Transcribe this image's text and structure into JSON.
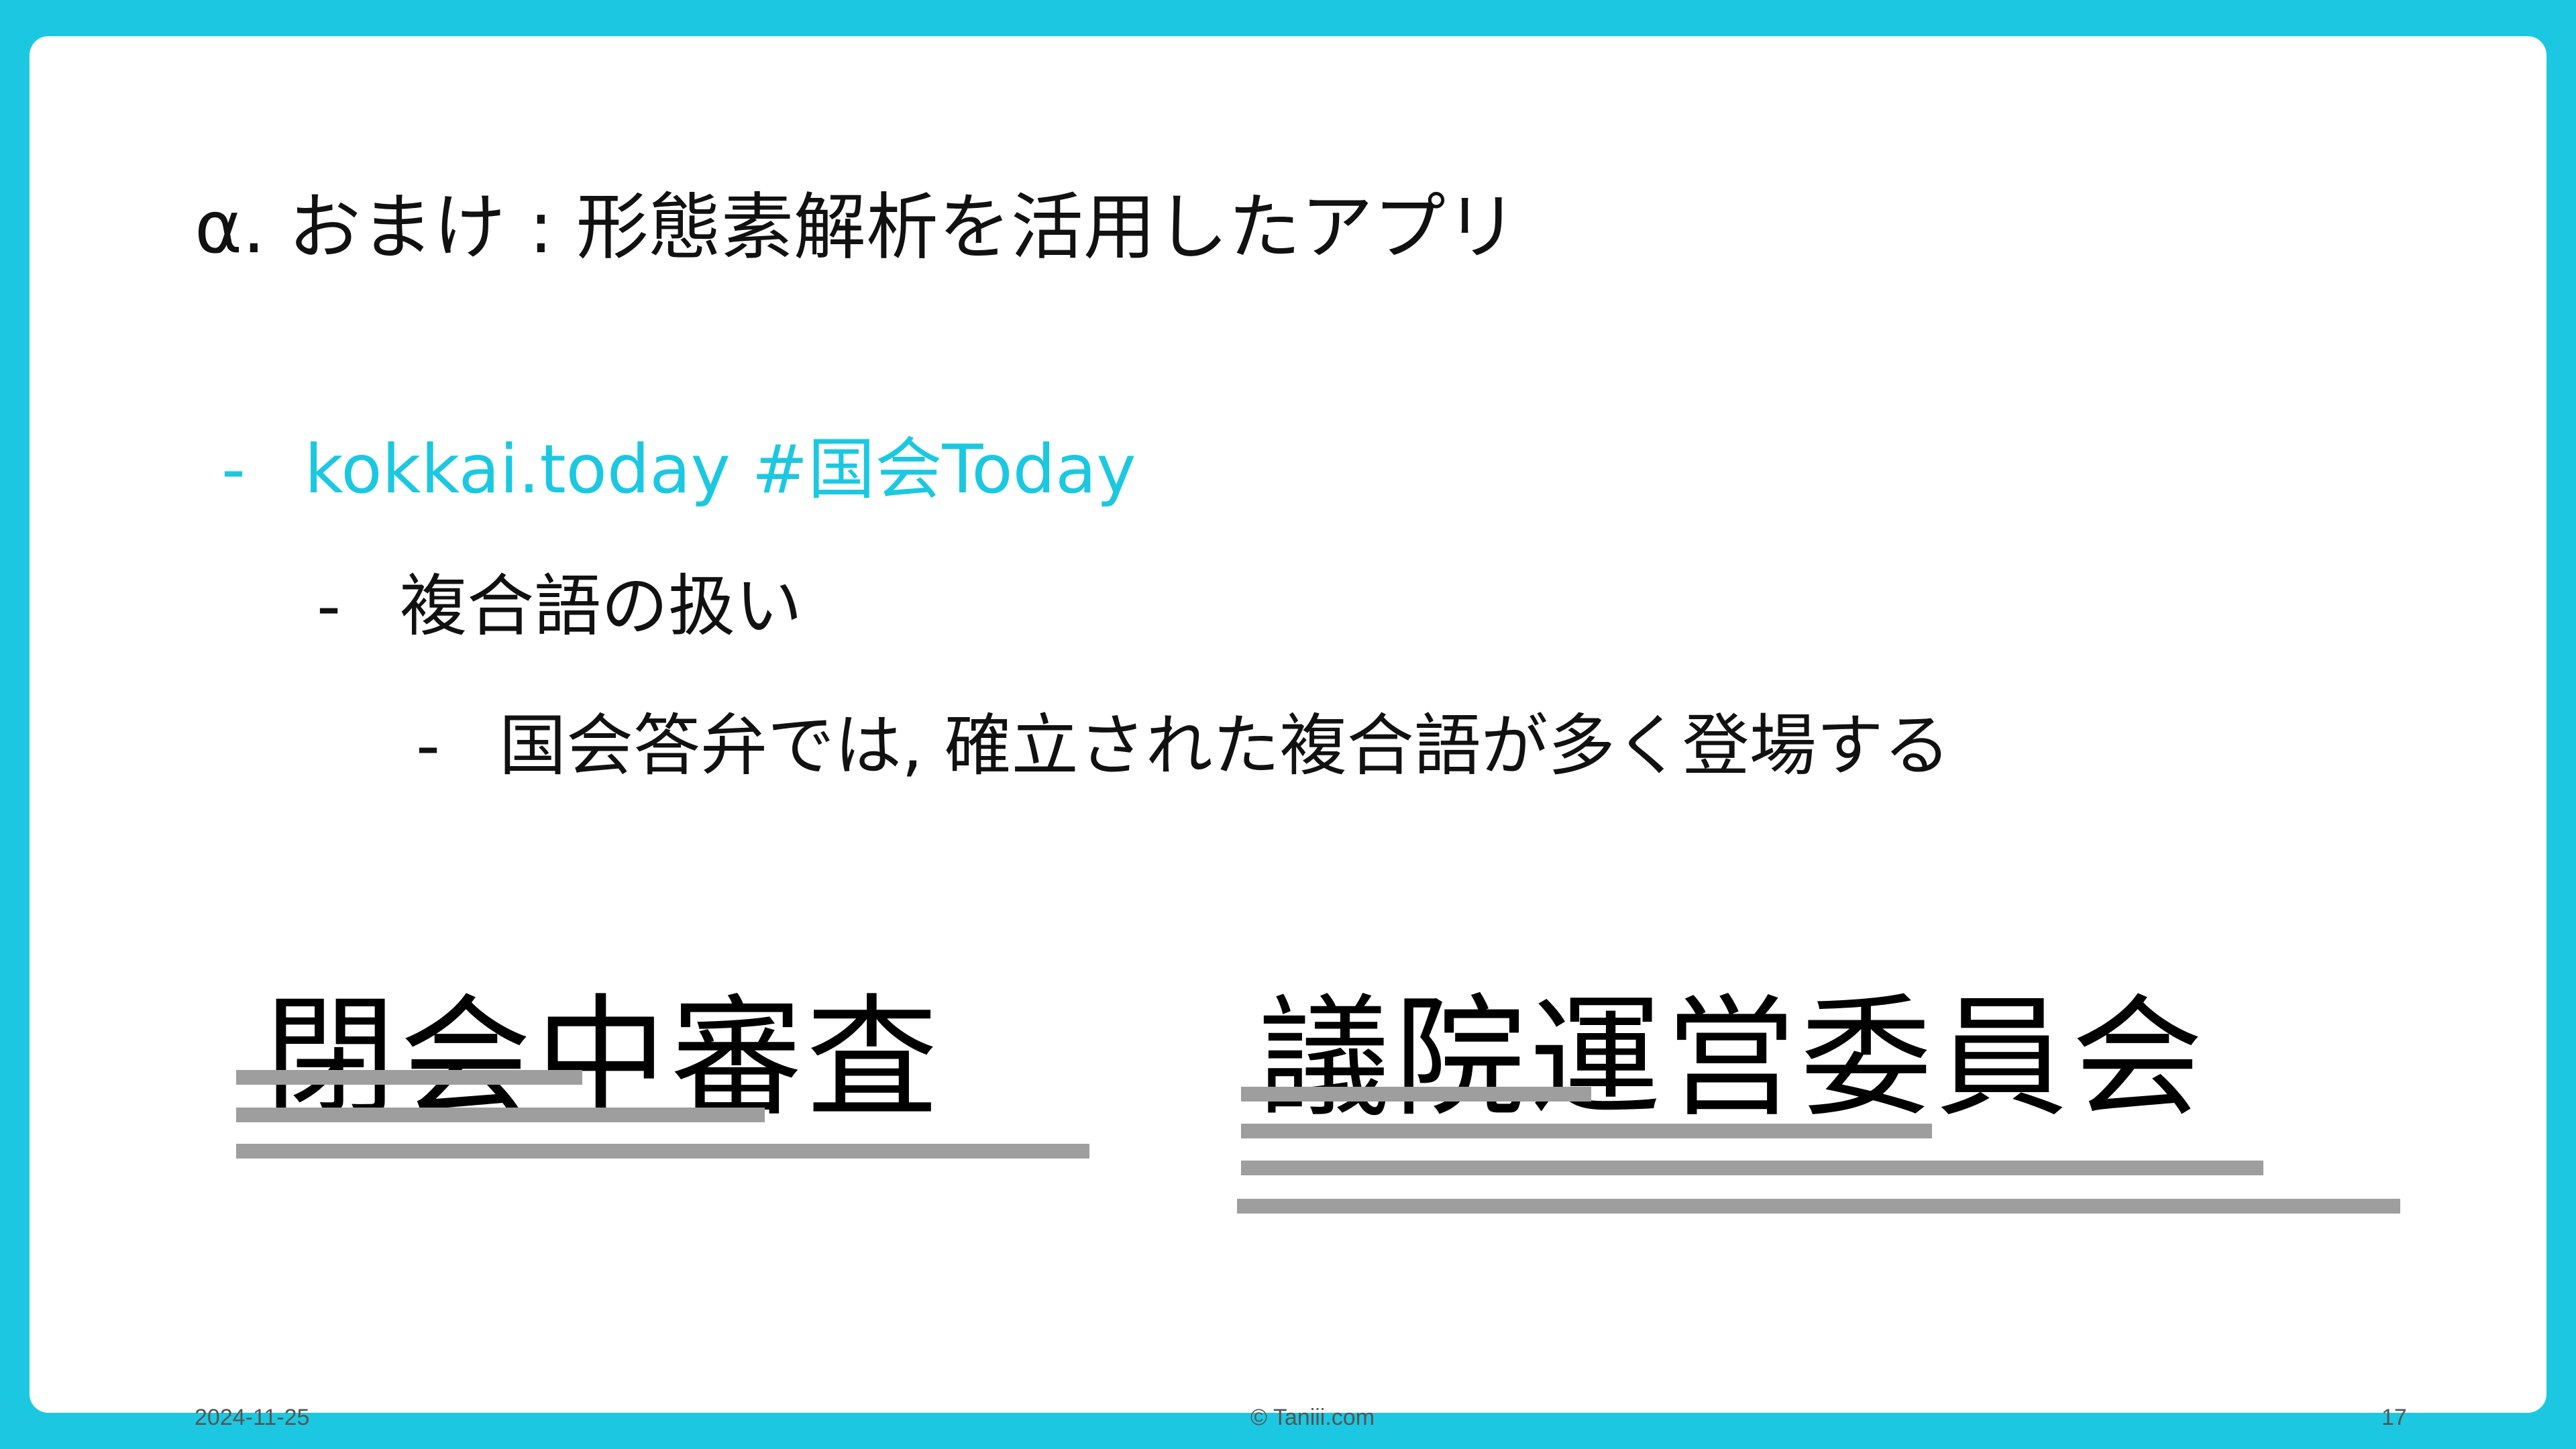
{
  "title": "α. おまけ : 形態素解析を活用したアプリ",
  "bullets": {
    "level1": {
      "dash": "-",
      "text": "kokkai.today #国会Today"
    },
    "level2": {
      "dash": "-",
      "text": "複合語の扱い"
    },
    "level3": {
      "dash": "-",
      "text": "国会答弁では, 確立された複合語が多く登場する"
    }
  },
  "examples": {
    "word1": "閉会中審査",
    "word2": "議院運営委員会"
  },
  "footer": {
    "date": "2024-11-25",
    "copyright": "© Taniii.com",
    "page": "17"
  },
  "colors": {
    "frame": "#1cc8e1",
    "accent_text": "#1cc8e1",
    "bar": "#9e9e9e"
  }
}
